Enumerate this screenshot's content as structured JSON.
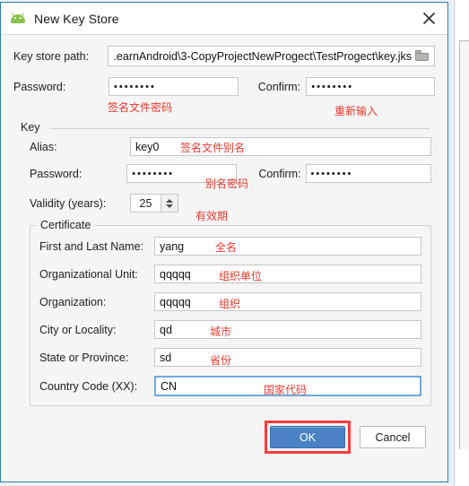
{
  "window": {
    "title": "New Key Store",
    "app_icon": "android-robot-icon",
    "close_icon": "close-icon"
  },
  "keystore": {
    "path_label": "Key store path:",
    "path_value": ".earnAndroid\\3-CopyProjectNewProgect\\TestProgect\\key.jks",
    "browse_icon": "folder-icon",
    "password_label": "Password:",
    "password_value": "••••••••",
    "confirm_label": "Confirm:",
    "confirm_value": "••••••••",
    "password_annotation": "签名文件密码",
    "confirm_annotation": "重新输入"
  },
  "key": {
    "group_label": "Key",
    "alias_label": "Alias:",
    "alias_value": "key0",
    "alias_annotation": "签名文件别名",
    "password_label": "Password:",
    "password_value": "••••••••",
    "password_annotation": "别名密码",
    "confirm_label": "Confirm:",
    "confirm_value": "••••••••",
    "validity_label": "Validity (years):",
    "validity_value": "25",
    "validity_annotation": "有效期"
  },
  "certificate": {
    "group_label": "Certificate",
    "fields": [
      {
        "label": "First and Last Name:",
        "value": "yang",
        "annotation": "全名"
      },
      {
        "label": "Organizational Unit:",
        "value": "qqqqq",
        "annotation": "组织单位"
      },
      {
        "label": "Organization:",
        "value": "qqqqq",
        "annotation": "组织"
      },
      {
        "label": "City or Locality:",
        "value": "qd",
        "annotation": "城市"
      },
      {
        "label": "State or Province:",
        "value": "sd",
        "annotation": "省份"
      },
      {
        "label": "Country Code (XX):",
        "value": "CN",
        "annotation": "国家代码"
      }
    ]
  },
  "buttons": {
    "ok_label": "OK",
    "cancel_label": "Cancel"
  },
  "colors": {
    "accent": "#4a82c4",
    "annotation": "#e8392f",
    "highlight": "#fb3b3b",
    "dialog_border": "#2e7ca8",
    "focus_border": "#6fa8dc"
  }
}
